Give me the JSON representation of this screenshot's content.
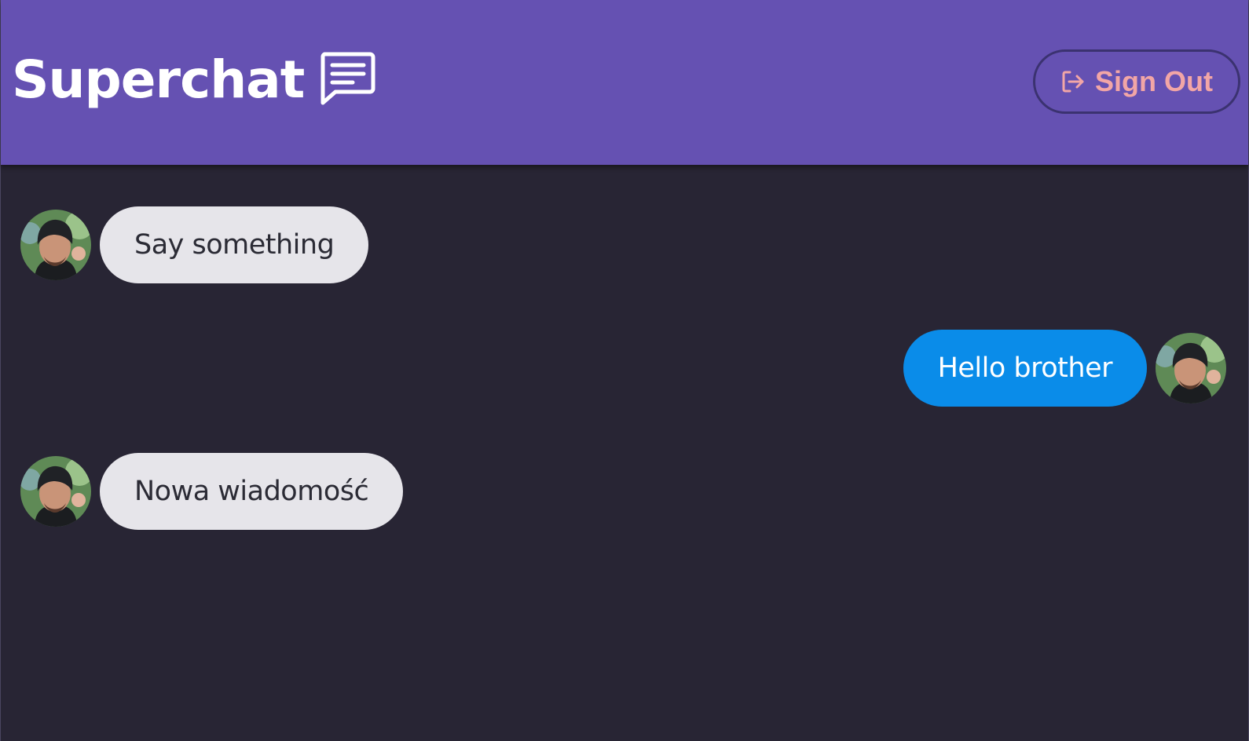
{
  "app": {
    "title": "Superchat",
    "icon": "chat-bubble-icon"
  },
  "header": {
    "signout": {
      "label": "Sign Out",
      "icon": "sign-out-icon"
    }
  },
  "colors": {
    "header_bg": "#6551b2",
    "page_bg": "#282534",
    "received_bubble": "#e6e5ea",
    "sent_bubble": "#0a8ce9",
    "signout_text": "#f2a6a6"
  },
  "messages": [
    {
      "direction": "received",
      "text": "Say something",
      "avatar": "user-avatar"
    },
    {
      "direction": "sent",
      "text": "Hello brother",
      "avatar": "user-avatar"
    },
    {
      "direction": "received",
      "text": "Nowa wiadomość",
      "avatar": "user-avatar"
    }
  ]
}
